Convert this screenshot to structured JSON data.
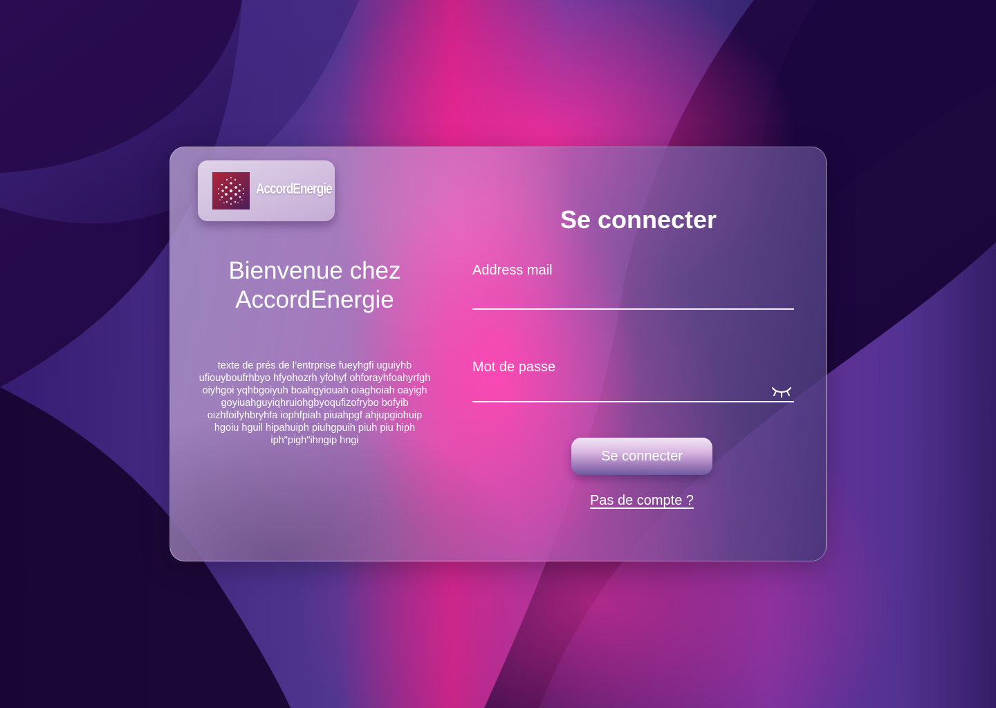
{
  "brand": {
    "name": "AccordEnergie",
    "logo_icon": "globe-dots-icon"
  },
  "welcome": {
    "title": "Bienvenue chez AccordEnergie",
    "description": "texte de prés de l’entrprise fueyhgfi uguiyhb ufiouyboufrhbyo hfyohozrh yfohyf ohforayhfoahyrfgh oiyhgoi yqhbgoiyuh boahgyiouah oiaghoiah oayigh goyiuahguyiqhruiohgbyoqufizofrybo bofyib oizhfoifyhbryhfa iophfpiah piuahpgf ahjupgiohuip hgoiu hguil hipahuiph piuhgpuih piuh piu hiph iph\"pigh\"ihngip hngi"
  },
  "login": {
    "title": "Se connecter",
    "email_label": "Address mail",
    "email_value": "",
    "password_label": "Mot de passe",
    "password_value": "",
    "password_toggle_icon": "eye-closed-icon",
    "submit_label": "Se connecter",
    "signup_link": "Pas de compte ?"
  },
  "colors": {
    "background": "#1a0637",
    "accent_pink": "#ff48b4",
    "accent_purple": "#5a3f9a"
  }
}
